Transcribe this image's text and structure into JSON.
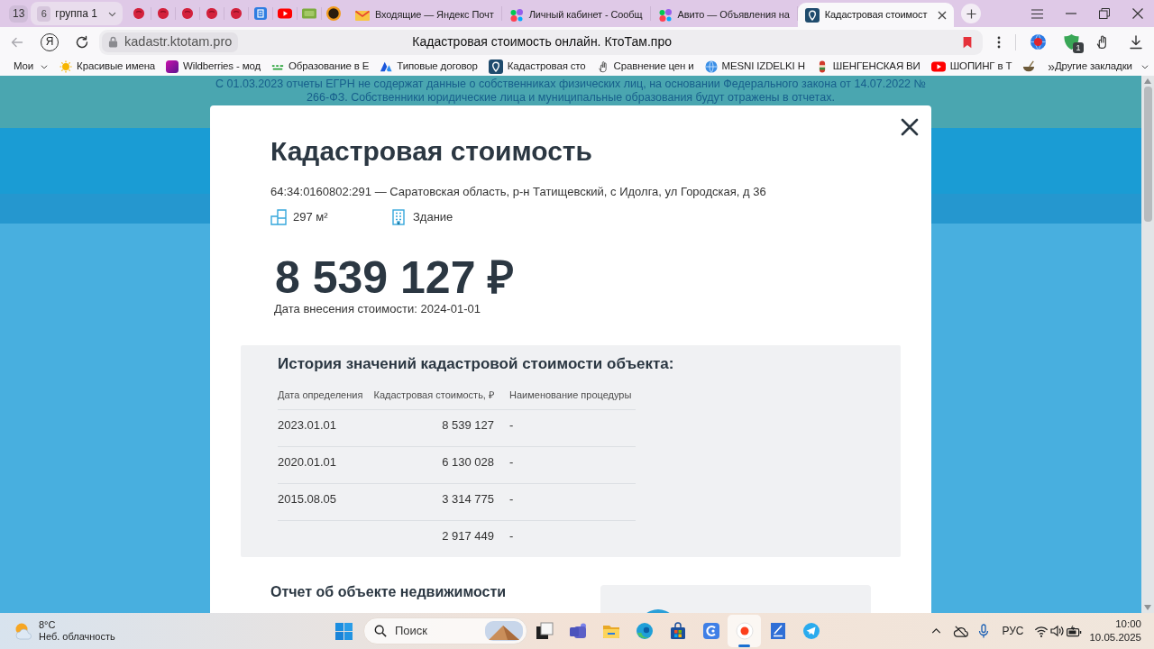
{
  "tab_strip": {
    "tab_count": "13",
    "group": {
      "count": "6",
      "label": "группа 1"
    },
    "pinned_tabs": [
      {
        "kind": "blob",
        "selected": false
      },
      {
        "kind": "blob",
        "selected": false
      },
      {
        "kind": "blob",
        "selected": false
      },
      {
        "kind": "blob",
        "selected": false
      },
      {
        "kind": "blob",
        "selected": false
      },
      {
        "kind": "doc",
        "selected": false
      },
      {
        "kind": "video",
        "selected": false
      },
      {
        "kind": "hd",
        "selected": false
      },
      {
        "kind": "coin",
        "selected": false
      }
    ],
    "tabs": [
      {
        "kind": "mail",
        "title": "Входящие — Яндекс Почт",
        "selected": false
      },
      {
        "kind": "dots",
        "title": "Личный кабинет - Сообщ",
        "selected": false
      },
      {
        "kind": "dots",
        "title": "Авито — Объявления на",
        "selected": false
      },
      {
        "kind": "pin",
        "title": "Кадастровая стоимост",
        "selected": true
      }
    ]
  },
  "toolbar": {
    "logo_letter": "Я",
    "url": "kadastr.ktotam.pro",
    "page_title": "Кадастровая стоимость онлайн. КтоТам.про",
    "bookmarked": true,
    "extension_badge": "1"
  },
  "bookmarks_bar": {
    "items": [
      {
        "kind": "folder",
        "label": "Мои"
      },
      {
        "kind": "sun",
        "label": "Красивые имена"
      },
      {
        "kind": "tile",
        "label": "Wildberries - мод"
      },
      {
        "kind": "dashes",
        "label": "Образование в Е"
      },
      {
        "kind": "peaks",
        "label": "Типовые договор"
      },
      {
        "kind": "pin",
        "label": "Кадастровая сто"
      },
      {
        "kind": "hand",
        "label": "Сравнение цен и"
      },
      {
        "kind": "globe",
        "label": "MESNI IZDELKI H"
      },
      {
        "kind": "capsule",
        "label": "ШЕНГЕНСКАЯ ВИ"
      },
      {
        "kind": "video",
        "label": "ШОПИНГ в Т"
      },
      {
        "kind": "bowl"
      }
    ],
    "overflow": "»",
    "other": "Другие закладки"
  },
  "page": {
    "notice": "С 01.03.2023 отчеты ЕГРН не содержат данные о собственниках физических лиц, на основании Федерального закона от 14.07.2022 № 266-ФЗ. Собственники юридические лица и муниципальные образования будут отражены в отчетах.",
    "modal": {
      "title": "Кадастровая стоимость",
      "address": "64:34:0160802:291 — Саратовская область, р-н Татищевский, с Идолга, ул Городская, д 36",
      "features": [
        {
          "kind": "area",
          "label": "297 м²"
        },
        {
          "kind": "building",
          "label": "Здание"
        }
      ],
      "price": "8 539 127 ₽",
      "price_date": "Дата внесения стоимости: 2024-01-01",
      "history": {
        "title": "История значений кадастровой стоимости объекта:",
        "columns": [
          "Дата определения",
          "Кадастровая стоимость, ₽",
          "Наименование процедуры"
        ],
        "rows": [
          {
            "date": "2023.01.01",
            "value": "8 539 127",
            "procedure": "-"
          },
          {
            "date": "2020.01.01",
            "value": "6 130 028",
            "procedure": "-"
          },
          {
            "date": "2015.08.05",
            "value": "3 314 775",
            "procedure": "-"
          },
          {
            "value": "2 917 449",
            "procedure": "-"
          }
        ]
      },
      "report": {
        "title": "Отчет об объекте недвижимости"
      }
    }
  },
  "taskbar": {
    "weather": {
      "temperature": "8°C",
      "condition": "Неб. облачность"
    },
    "search_label": "Поиск",
    "apps": [
      {
        "kind": "tasks",
        "selected": false
      },
      {
        "kind": "chat",
        "selected": false
      },
      {
        "kind": "files",
        "selected": false
      },
      {
        "kind": "browser",
        "selected": false
      },
      {
        "kind": "store",
        "selected": false
      },
      {
        "kind": "cycle",
        "selected": false
      },
      {
        "kind": "yandex",
        "selected": true
      },
      {
        "kind": "editor",
        "selected": false
      },
      {
        "kind": "telegram",
        "selected": false
      }
    ],
    "language": "РУС",
    "time": "10:00",
    "date": "10.05.2025"
  }
}
